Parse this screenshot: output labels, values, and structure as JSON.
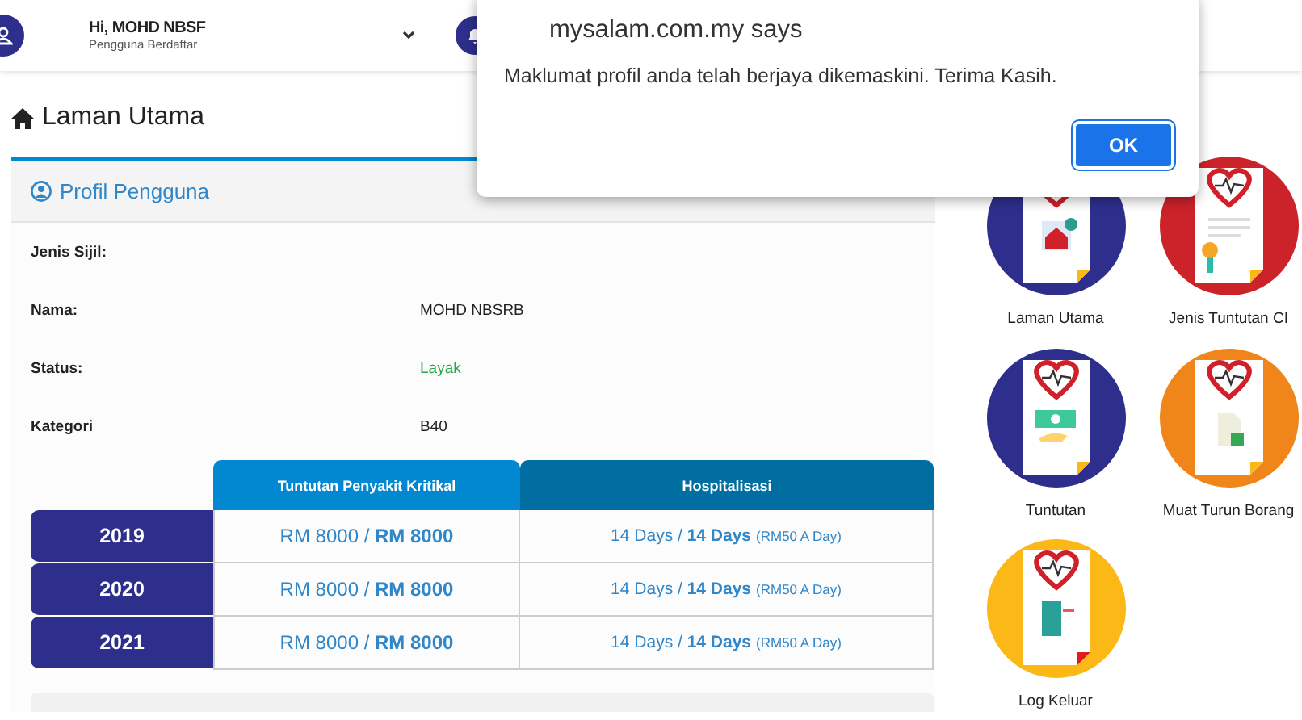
{
  "header": {
    "greeting": "Hi, MOHD NBSF",
    "role": "Pengguna Berdaftar"
  },
  "page_title": "Laman Utama",
  "profile": {
    "title": "Profil Pengguna",
    "rows": [
      {
        "label": "Jenis Sijil:"
      },
      {
        "label": "Nama:",
        "value": "MOHD NBSRB"
      },
      {
        "label": "Status:",
        "value": "Layak",
        "color": "#28a745"
      },
      {
        "label": "Kategori",
        "value": "B40"
      }
    ]
  },
  "table": {
    "columns": [
      "Tuntutan Penyakit Kritikal",
      "Hospitalisasi"
    ],
    "rows": [
      {
        "year": "2019",
        "critical": "RM 8000 / **RM 8000**",
        "hospital": "14 Days / **14 Days**",
        "rate": "(RM50 A Day)"
      },
      {
        "year": "2020",
        "critical": "RM 8000 / **RM 8000**",
        "hospital": "14 Days / **14 Days**",
        "rate": "(RM50 A Day)"
      },
      {
        "year": "2021",
        "critical": "RM 8000 / **RM 8000**",
        "hospital": "14 Days / **14 Days**",
        "rate": "(RM50 A Day)"
      }
    ]
  },
  "tiles": [
    {
      "label": "Laman Utama",
      "color": "#2e2f8c",
      "kind": "home"
    },
    {
      "label": "Jenis Tuntutan CI",
      "color": "#cc2229",
      "kind": "certificate"
    },
    {
      "label": "Tuntutan",
      "color": "#2e2f8c",
      "kind": "money"
    },
    {
      "label": "Muat Turun Borang",
      "color": "#f0851a",
      "kind": "download"
    },
    {
      "label": "Log Keluar",
      "color": "#fbb817",
      "kind": "logout"
    }
  ],
  "dialog": {
    "title": "mysalam.com.my says",
    "message": "Maklumat profil anda telah berjaya dikemaskini. Terima Kasih.",
    "button": "OK"
  }
}
